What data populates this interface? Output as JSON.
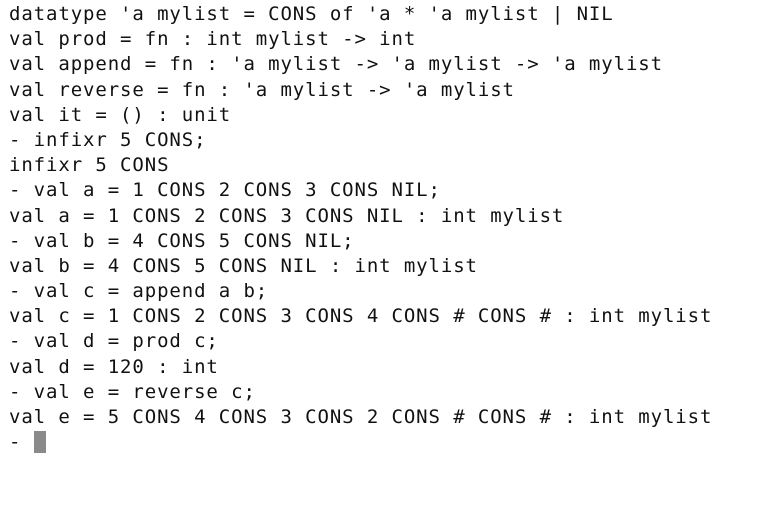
{
  "terminal": {
    "lines": [
      "datatype 'a mylist = CONS of 'a * 'a mylist | NIL",
      "val prod = fn : int mylist -> int",
      "val append = fn : 'a mylist -> 'a mylist -> 'a mylist",
      "val reverse = fn : 'a mylist -> 'a mylist",
      "val it = () : unit",
      "- infixr 5 CONS;",
      "infixr 5 CONS",
      "- val a = 1 CONS 2 CONS 3 CONS NIL;",
      "val a = 1 CONS 2 CONS 3 CONS NIL : int mylist",
      "- val b = 4 CONS 5 CONS NIL;",
      "val b = 4 CONS 5 CONS NIL : int mylist",
      "- val c = append a b;",
      "val c = 1 CONS 2 CONS 3 CONS 4 CONS # CONS # : int mylist",
      "- val d = prod c;",
      "val d = 120 : int",
      "- val e = reverse c;",
      "val e = 5 CONS 4 CONS 3 CONS 2 CONS # CONS # : int mylist"
    ],
    "prompt": "- ",
    "cursor_color": "#8a8a8a"
  }
}
